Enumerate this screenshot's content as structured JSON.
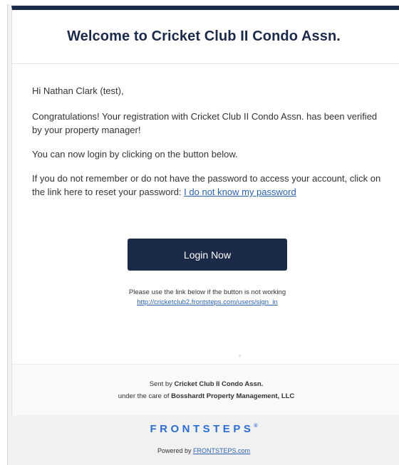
{
  "email": {
    "title": "Welcome to Cricket Club II Condo Assn.",
    "greeting": "Hi Nathan Clark (test),",
    "congrats_text": "Congratulations! Your registration with Cricket Club II Condo Assn. has been verified by your property manager!",
    "login_hint": "You can now login by clicking on the button below.",
    "reset_text": "If you do not remember or do not have the password to access your account, click on the link here to reset your password: ",
    "reset_link_label": "I do not know my password",
    "login_button_label": "Login Now",
    "fallback_text": "Please use the link below if the button is not working",
    "fallback_link": "http://cricketclub2.frontsteps.com/users/sign_in"
  },
  "footer": {
    "sent_by_prefix": "Sent by ",
    "sent_by_name": "Cricket Club II Condo Assn.",
    "care_prefix": "under the care of ",
    "care_name": "Bosshardt Property Management, LLC",
    "brand": "FRONTSTEPS",
    "brand_mark": "®",
    "powered_prefix": "Powered by ",
    "powered_link": "FRONTSTEPS.com"
  },
  "colors": {
    "navy": "#1c2a4a",
    "link": "#2b62b0",
    "brand_blue": "#2b6dd0"
  }
}
